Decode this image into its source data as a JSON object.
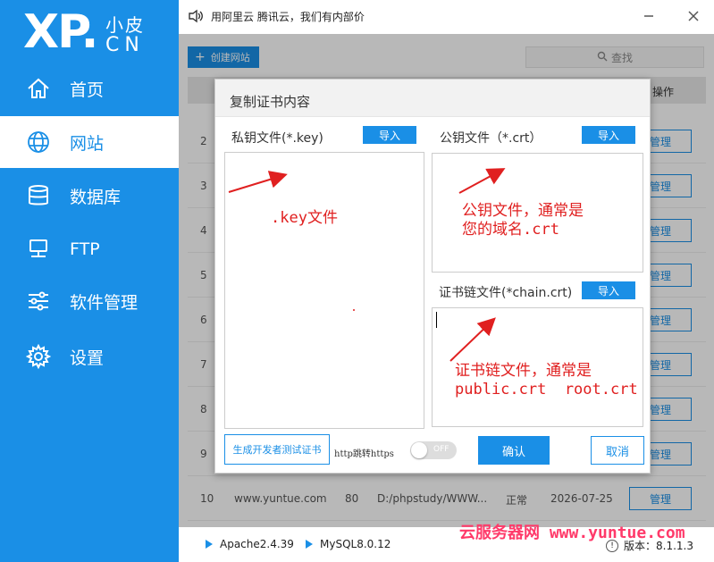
{
  "logo": {
    "main": "XP.",
    "cn_top": "小皮",
    "cn_bottom": "CN"
  },
  "sidebar": {
    "items": [
      {
        "label": "首页",
        "icon": "home-icon"
      },
      {
        "label": "网站",
        "icon": "globe-icon",
        "active": true
      },
      {
        "label": "数据库",
        "icon": "database-icon"
      },
      {
        "label": "FTP",
        "icon": "server-icon"
      },
      {
        "label": "软件管理",
        "icon": "sliders-icon"
      },
      {
        "label": "设置",
        "icon": "gear-icon"
      }
    ]
  },
  "titlebar": {
    "notice": "用阿里云 腾讯云，我们有内部价"
  },
  "main": {
    "create_label": "创建网站",
    "search_placeholder": "查找",
    "op_header": "操作",
    "manage_label": "管理",
    "rows": [
      {
        "num": "2"
      },
      {
        "num": "3"
      },
      {
        "num": "4"
      },
      {
        "num": "5"
      },
      {
        "num": "6"
      },
      {
        "num": "7"
      },
      {
        "num": "8"
      },
      {
        "num": "9"
      },
      {
        "num": "10",
        "domain": "www.yuntue.com",
        "port": "80",
        "path": "D:/phpstudy/WWW...",
        "status": "正常",
        "date": "2026-07-25"
      }
    ]
  },
  "status": {
    "apache": "Apache2.4.39",
    "mysql": "MySQL8.0.12",
    "watermark": "云服务器网 www.yuntue.com",
    "version": "版本：8.1.1.3"
  },
  "dialog": {
    "title": "复制证书内容",
    "private_key_label": "私钥文件(*.key)",
    "public_key_label": "公钥文件（*.crt）",
    "chain_label": "证书链文件(*chain.crt)",
    "import_label": "导入",
    "note_key": ".key文件",
    "note_crt_1": "公钥文件，通常是",
    "note_crt_2": "您的域名.crt",
    "note_chain_1": "证书链文件，通常是",
    "note_chain_2": "public.crt  root.crt",
    "dev_cert_label": "生成开发者测试证书",
    "http_redirect_label": "http跳转https",
    "toggle_state": "OFF",
    "ok_label": "确认",
    "cancel_label": "取消"
  },
  "colors": {
    "accent": "#1a8fe6",
    "annotation": "#e02020",
    "watermark": "#ff3a6a"
  }
}
